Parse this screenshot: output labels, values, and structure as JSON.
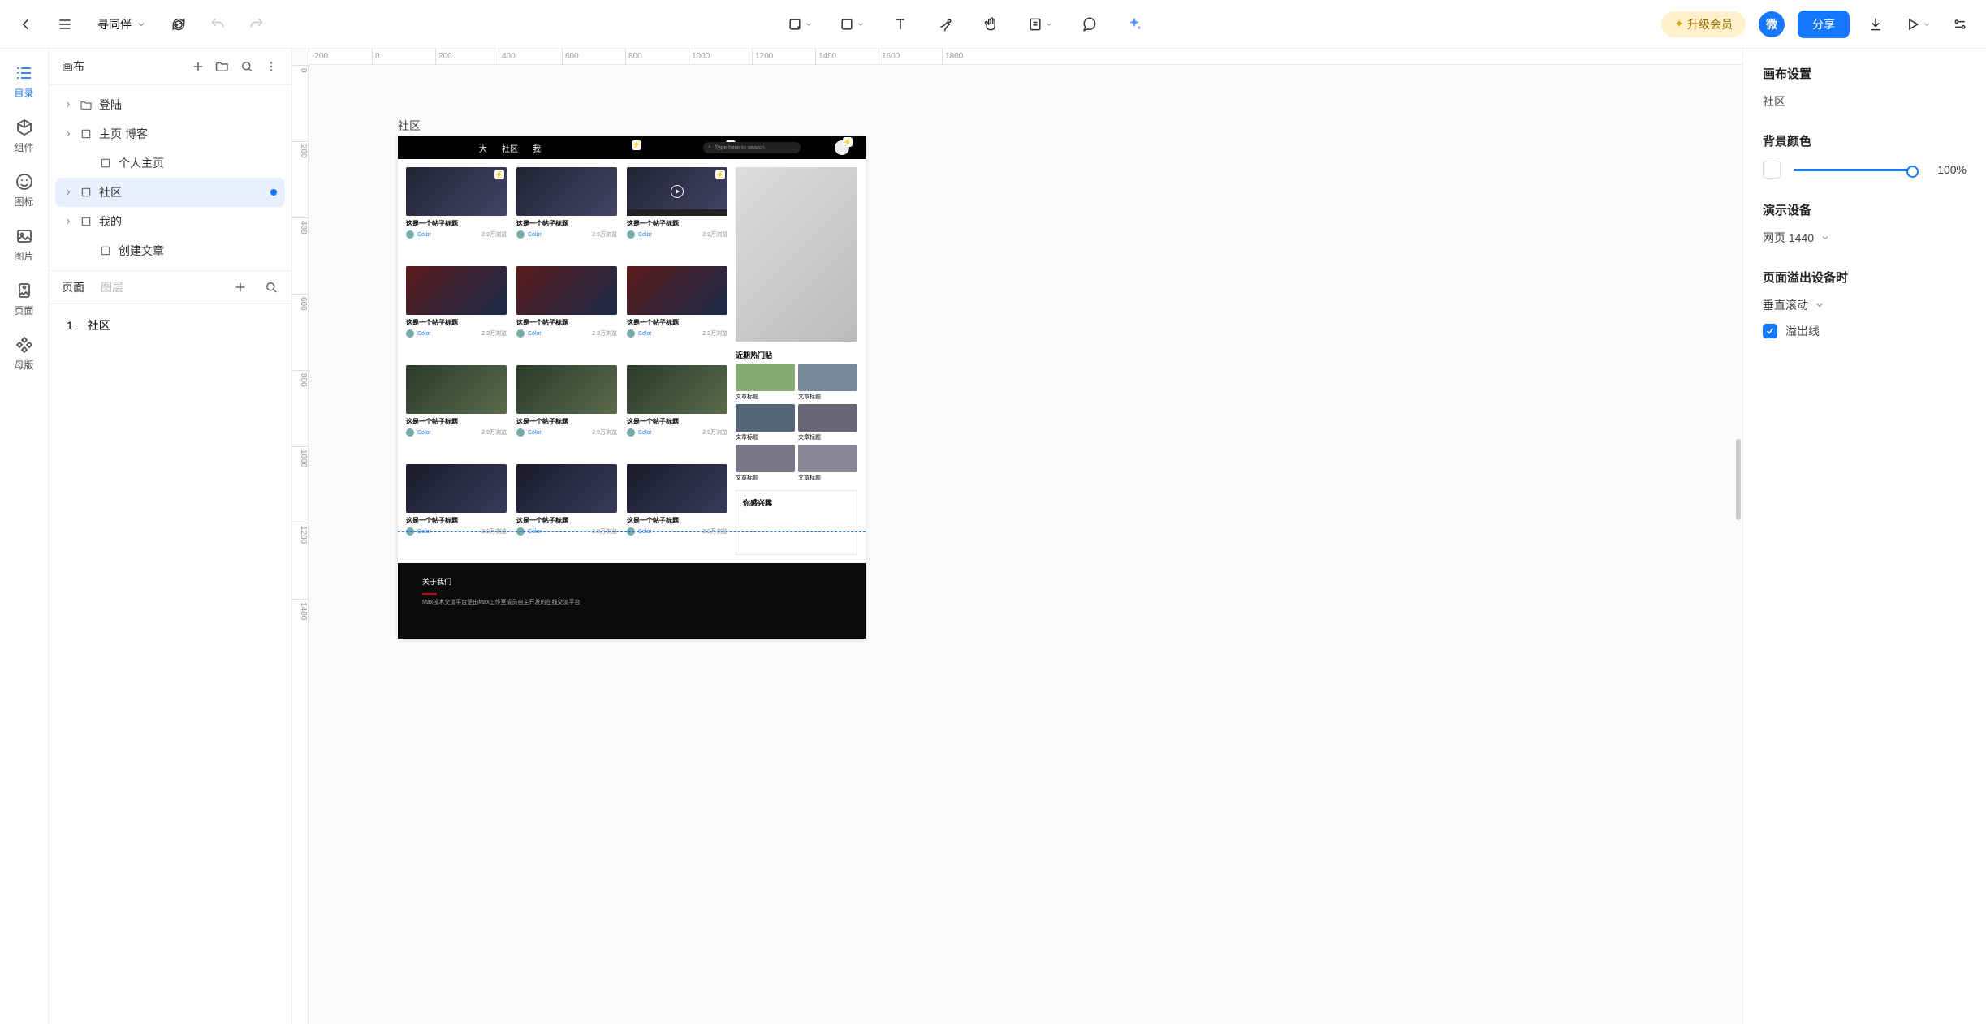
{
  "doc_title": "寻同伴",
  "topbar": {
    "upgrade": "升级会员",
    "wei": "微",
    "share": "分享"
  },
  "iconbar": [
    {
      "label": "目录"
    },
    {
      "label": "组件"
    },
    {
      "label": "图标"
    },
    {
      "label": "图片"
    },
    {
      "label": "页面"
    },
    {
      "label": "母版"
    }
  ],
  "left": {
    "header": "画布",
    "tree": [
      {
        "label": "登陆",
        "icon": "folder",
        "chev": true
      },
      {
        "label": "主页 博客",
        "icon": "artboard",
        "chev": true
      },
      {
        "label": "个人主页",
        "icon": "artboard",
        "indent": true
      },
      {
        "label": "社区",
        "icon": "artboard",
        "chev": true,
        "active": true,
        "dot": true
      },
      {
        "label": "我的",
        "icon": "artboard",
        "chev": true
      },
      {
        "label": "创建文章",
        "icon": "artboard",
        "indent": true
      }
    ],
    "tabs": {
      "a": "页面",
      "b": "图层"
    },
    "pages": [
      {
        "num": "1",
        "label": "社区"
      }
    ]
  },
  "ruler_h": [
    "-200",
    "0",
    "200",
    "400",
    "600",
    "800",
    "1000",
    "1200",
    "1400",
    "1600",
    "1800"
  ],
  "ruler_v": [
    "0",
    "200",
    "400",
    "600",
    "800",
    "1000",
    "1200",
    "1400"
  ],
  "canvas": {
    "artboard_label": "社区",
    "header": {
      "nav": [
        "大",
        "社区",
        "我"
      ],
      "search_ph": "Type here to search"
    },
    "card_title": "这是一个帖子标题",
    "author": "Color",
    "views": "2.9万浏览",
    "side_hot": "近期热门贴",
    "thumb_label": "文章标题",
    "interest": "你感兴趣",
    "footer_title": "关于我们",
    "footer_desc": "Max技术交流平台是由Max工作室成员自主开发的在线交流平台"
  },
  "right": {
    "section1": {
      "title": "画布设置",
      "value": "社区"
    },
    "section2": {
      "title": "背景颜色",
      "pct": "100%"
    },
    "section3": {
      "title": "演示设备",
      "value": "网页 1440"
    },
    "section4": {
      "title": "页面溢出设备时",
      "value": "垂直滚动",
      "chk": "溢出线"
    }
  }
}
